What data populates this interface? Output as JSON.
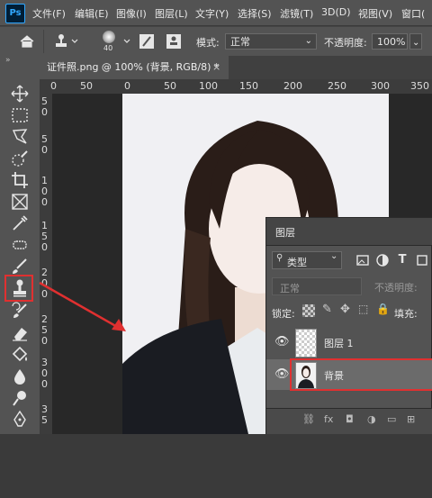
{
  "app": {
    "logo": "Ps"
  },
  "menu": [
    "文件(F)",
    "编辑(E)",
    "图像(I)",
    "图层(L)",
    "文字(Y)",
    "选择(S)",
    "滤镜(T)",
    "3D(D)",
    "视图(V)",
    "窗口("
  ],
  "options": {
    "brush_size": "40",
    "mode_label": "模式:",
    "mode_value": "正常",
    "opacity_label": "不透明度:",
    "opacity_value": "100%"
  },
  "document_tab": {
    "title": "证件照.png @ 100% (背景, RGB/8) *",
    "close": "×"
  },
  "ruler": {
    "horizontal": [
      "0",
      "50",
      "0",
      "50",
      "100",
      "150",
      "200",
      "250",
      "300",
      "350"
    ],
    "vertical": [
      "5",
      "0",
      "5",
      "0",
      "1",
      "0",
      "0",
      "1",
      "5",
      "0",
      "2",
      "0",
      "0",
      "2",
      "5",
      "0",
      "3",
      "0",
      "0",
      "3",
      "5"
    ]
  },
  "toolbar_collapse": "»",
  "layers_panel": {
    "title": "图层",
    "filter_type": "类型",
    "blend_mode": "正常",
    "opacity_label": "不透明度:",
    "lock_label": "锁定:",
    "fill_label": "填充:",
    "layers": [
      {
        "name": "图层 1",
        "selected": false
      },
      {
        "name": "背景",
        "selected": true
      }
    ]
  },
  "colors": {
    "accent_highlight": "#e03030",
    "selected_layer": "#6b6b6b"
  }
}
